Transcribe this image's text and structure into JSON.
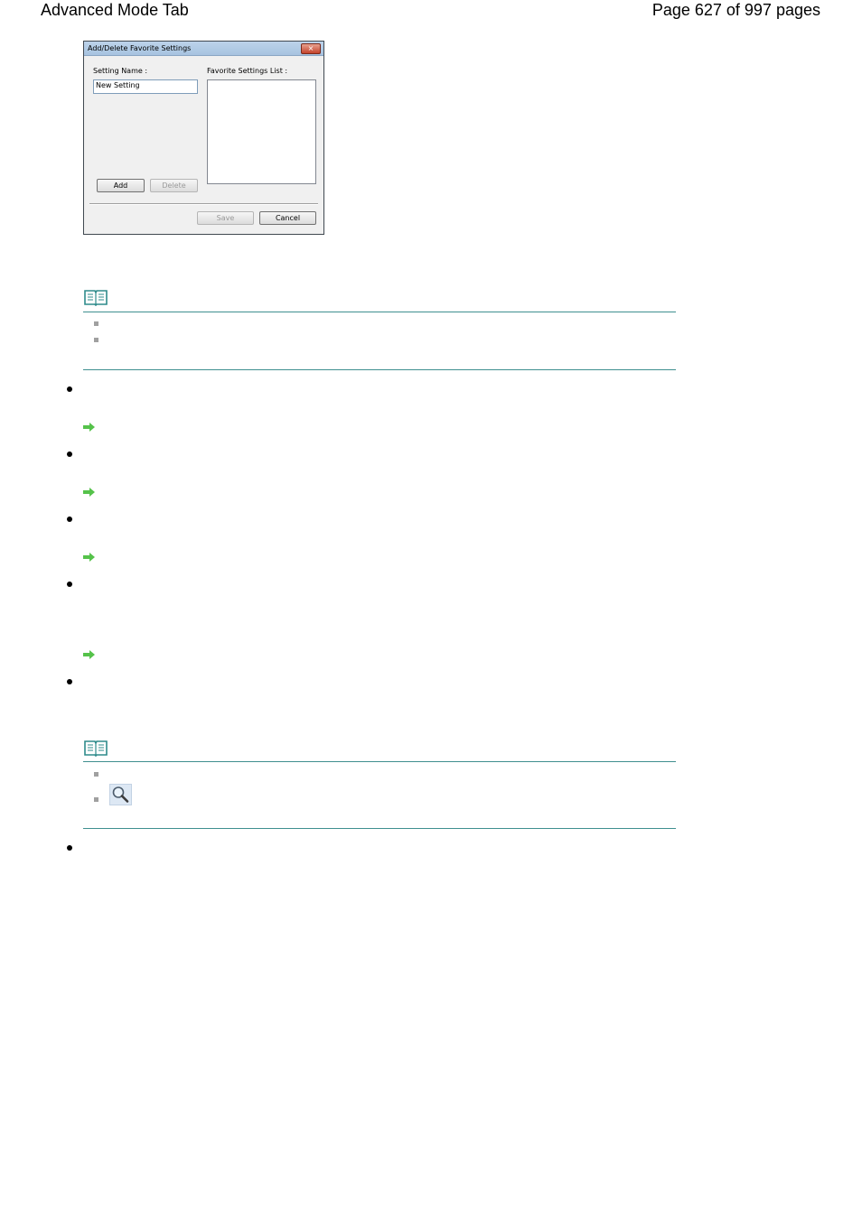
{
  "header": {
    "left": "Advanced Mode Tab",
    "right": "Page 627 of 997 pages"
  },
  "dialog": {
    "title": "Add/Delete Favorite Settings",
    "close_glyph": "×",
    "setting_name_label": "Setting Name :",
    "setting_name_value": "New Setting",
    "favorites_label": "Favorite Settings List :",
    "add_label": "Add",
    "delete_label": "Delete",
    "save_label": "Save",
    "cancel_label": "Cancel"
  },
  "colors": {
    "rule": "#3f8f8f",
    "arrow": "#55c24a",
    "note_icon": "#2e8b8b",
    "square_bullet": "#a0a0a0"
  },
  "icons": {
    "note": "note-book-icon",
    "link_arrow": "arrow-right-icon",
    "zoom": "magnifier-icon"
  }
}
